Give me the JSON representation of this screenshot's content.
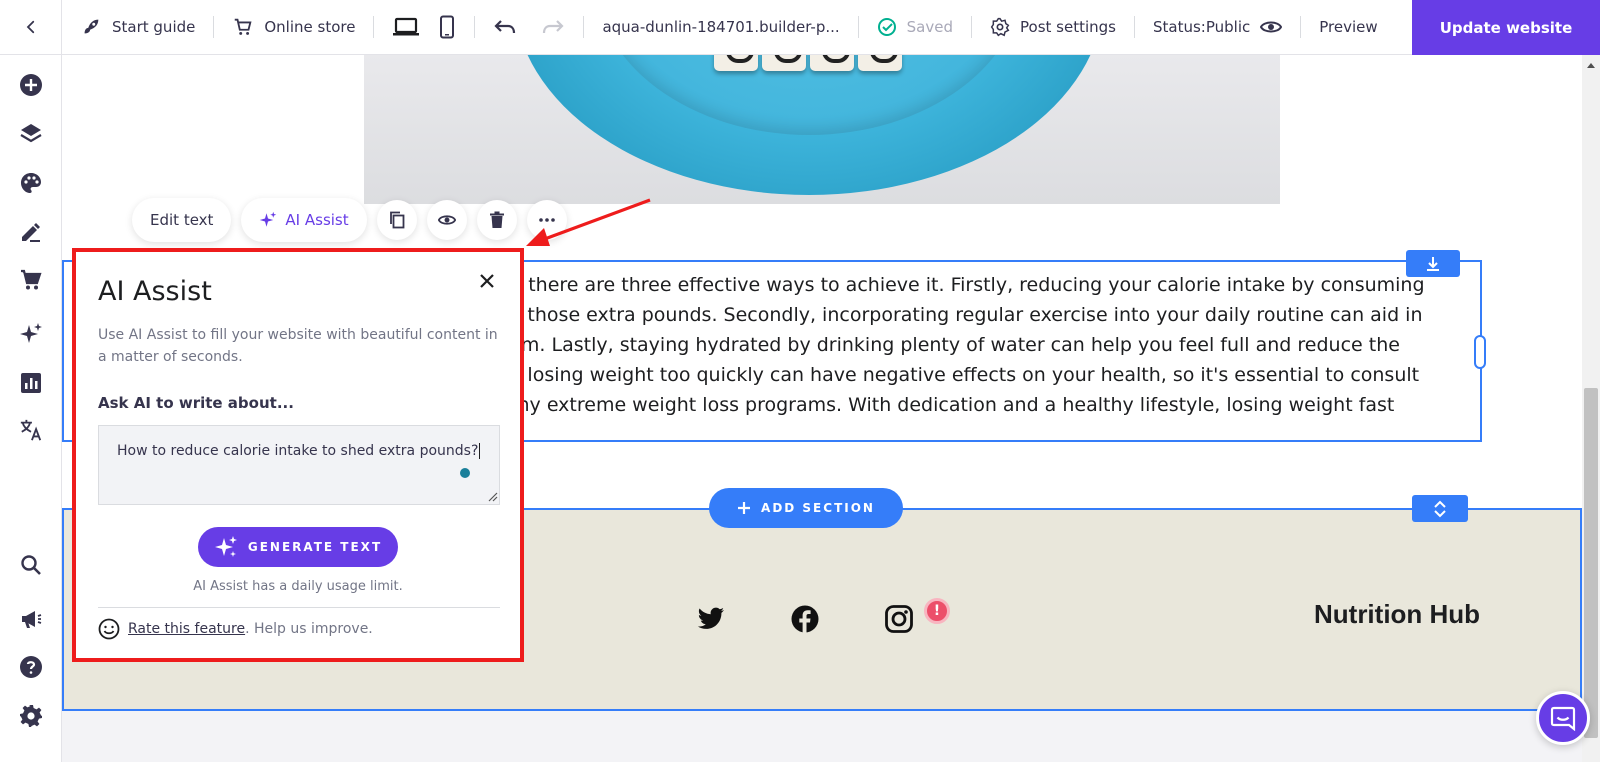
{
  "topbar": {
    "start_guide": "Start guide",
    "online_store": "Online store",
    "url": "aqua-dunlin-184701.builder-p...",
    "saved": "Saved",
    "post_settings": "Post settings",
    "status": "Status:Public",
    "preview": "Preview",
    "update": "Update website"
  },
  "toolbar": {
    "edit_text": "Edit text",
    "ai_assist": "AI Assist"
  },
  "content": {
    "lines": [
      "ask, but there are three effective ways to achieve it. Firstly, reducing your calorie intake by consuming",
      "ou shed those extra pounds. Secondly, incorporating regular exercise into your daily routine can aid in",
      "etabolism. Lastly, staying hydrated by drinking plenty of water can help you feel full and reduce the",
      "ote that losing weight too quickly can have negative effects on your health, so it's essential to consult",
      "ng on any extreme weight loss programs. With dedication and a healthy lifestyle, losing weight fast"
    ],
    "add_section": "ADD SECTION"
  },
  "footer": {
    "brand": "Nutrition Hub",
    "alert": "!"
  },
  "ai_panel": {
    "title": "AI Assist",
    "description": "Use AI Assist to fill your website with beautiful content in a matter of seconds.",
    "ask_label": "Ask AI to write about...",
    "prompt_value": "How to reduce calorie intake to shed extra pounds?",
    "generate": "GENERATE TEXT",
    "limit": "AI Assist has a daily usage limit.",
    "rate_link": "Rate this feature",
    "rate_suffix": ". Help us improve."
  },
  "colors": {
    "accent": "#673de6",
    "selection": "#357df9",
    "highlight": "#ee1c1c",
    "footer_bg": "#e9e7db"
  }
}
